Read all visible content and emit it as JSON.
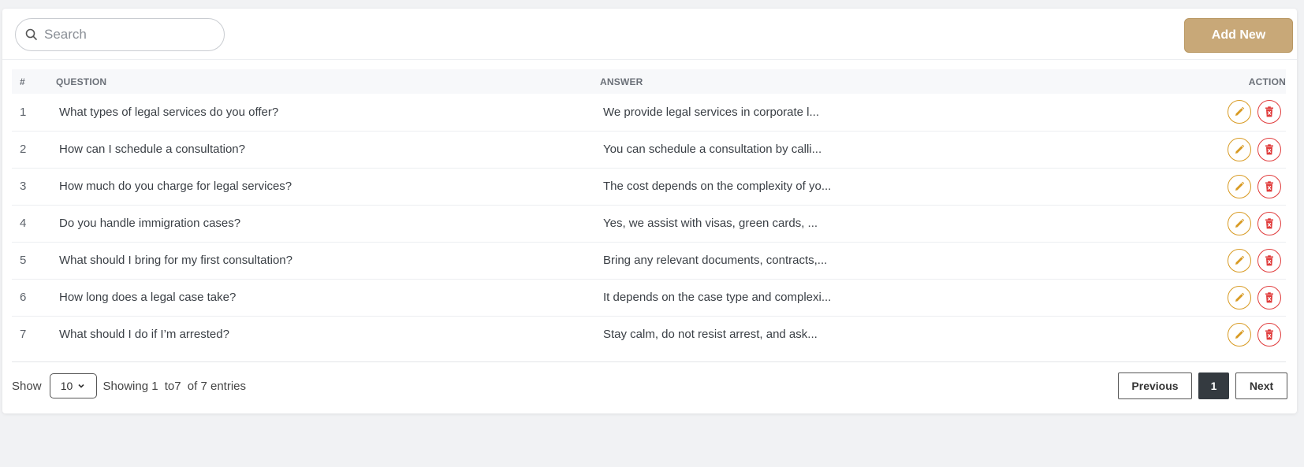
{
  "toolbar": {
    "search_placeholder": "Search",
    "add_label": "Add New"
  },
  "table": {
    "headers": {
      "num": "#",
      "question": "QUESTION",
      "answer": "ANSWER",
      "action": "ACTION"
    },
    "rows": [
      {
        "num": "1",
        "question": "What types of legal services do you offer?",
        "answer": "We provide legal services in corporate l..."
      },
      {
        "num": "2",
        "question": "How can I schedule a consultation?",
        "answer": "You can schedule a consultation by calli..."
      },
      {
        "num": "3",
        "question": "How much do you charge for legal services?",
        "answer": "The cost depends on the complexity of yo..."
      },
      {
        "num": "4",
        "question": "Do you handle immigration cases?",
        "answer": "Yes, we assist with visas, green cards, ..."
      },
      {
        "num": "5",
        "question": "What should I bring for my first consultation?",
        "answer": "Bring any relevant documents, contracts,..."
      },
      {
        "num": "6",
        "question": "How long does a legal case take?",
        "answer": "It depends on the case type and complexi..."
      },
      {
        "num": "7",
        "question": "What should I do if I’m arrested?",
        "answer": "Stay calm, do not resist arrest, and ask..."
      }
    ],
    "row_actions": {
      "edit_icon": "pencil-icon",
      "delete_icon": "trash-icon"
    }
  },
  "footer": {
    "show_label": "Show",
    "page_size": "10",
    "showing_prefix": "Showing 1",
    "showing_to": "to7",
    "showing_of": "of 7 entries",
    "prev_label": "Previous",
    "current_page": "1",
    "next_label": "Next"
  },
  "colors": {
    "accent": "#c8a878",
    "edit": "#d89a22",
    "delete": "#e03b3b",
    "active_page": "#343a40"
  }
}
